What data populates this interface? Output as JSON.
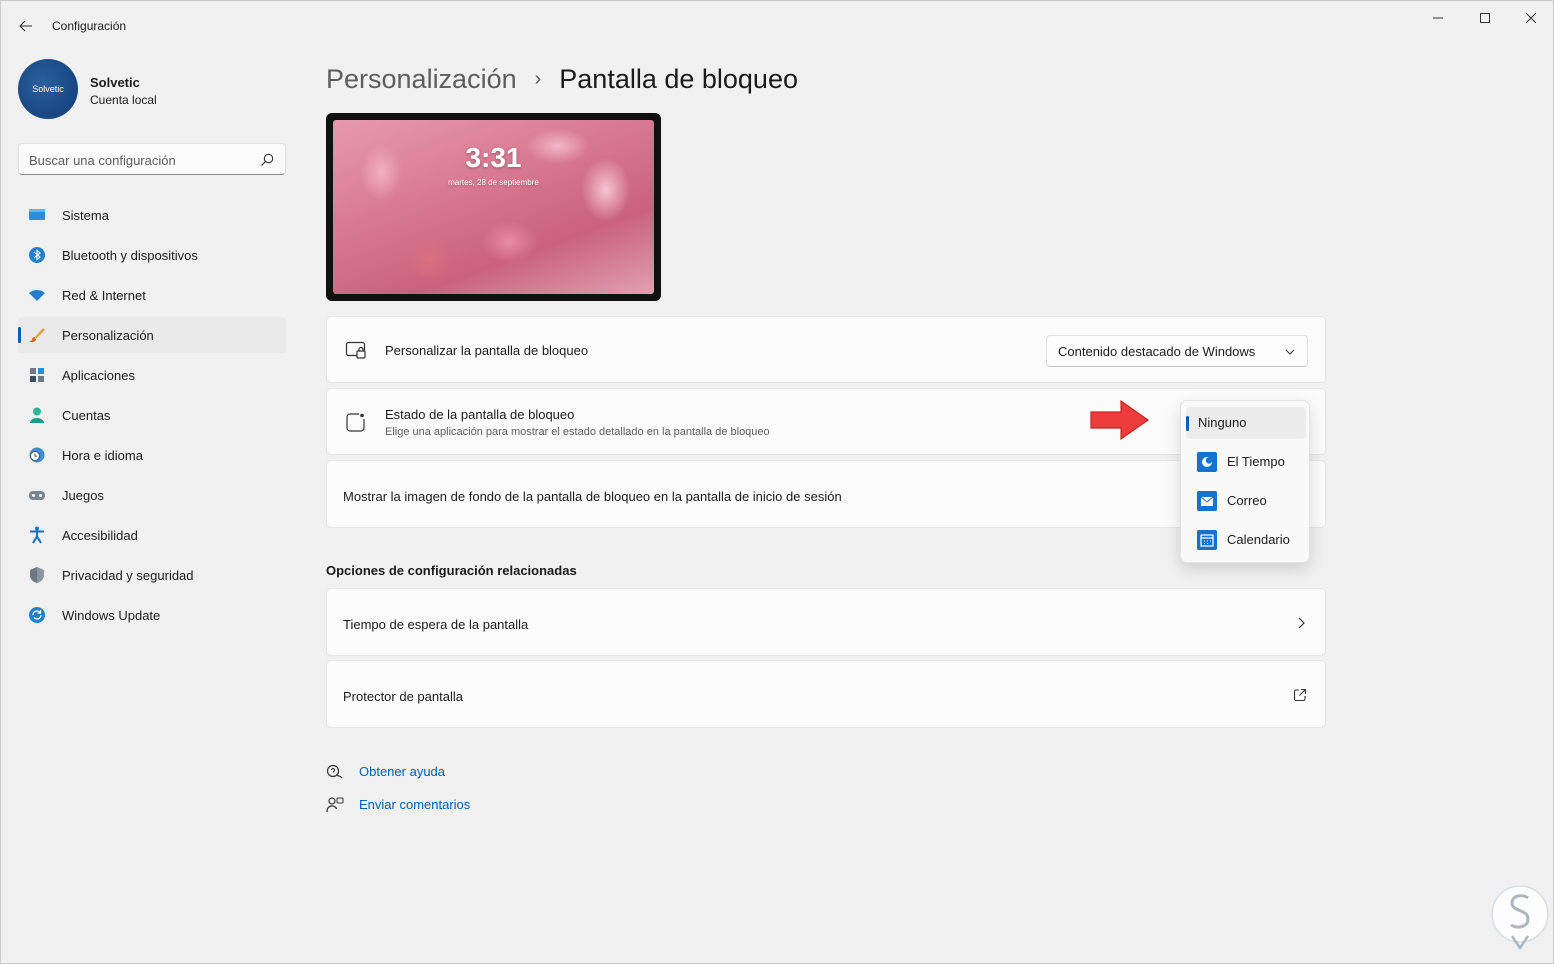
{
  "window": {
    "title": "Configuración",
    "controls": {
      "minimize": "minimize-icon",
      "maximize": "maximize-icon",
      "close": "close-icon"
    }
  },
  "profile": {
    "avatar_text": "Solvetic",
    "name": "Solvetic",
    "account": "Cuenta local"
  },
  "search": {
    "placeholder": "Buscar una configuración"
  },
  "sidebar": {
    "items": [
      {
        "label": "Sistema",
        "icon": "system-icon"
      },
      {
        "label": "Bluetooth y dispositivos",
        "icon": "bluetooth-icon"
      },
      {
        "label": "Red & Internet",
        "icon": "wifi-icon"
      },
      {
        "label": "Personalización",
        "icon": "brush-icon",
        "active": true
      },
      {
        "label": "Aplicaciones",
        "icon": "apps-icon"
      },
      {
        "label": "Cuentas",
        "icon": "person-icon"
      },
      {
        "label": "Hora e idioma",
        "icon": "clock-globe-icon"
      },
      {
        "label": "Juegos",
        "icon": "gamepad-icon"
      },
      {
        "label": "Accesibilidad",
        "icon": "accessibility-icon"
      },
      {
        "label": "Privacidad y seguridad",
        "icon": "shield-icon"
      },
      {
        "label": "Windows Update",
        "icon": "update-icon"
      }
    ]
  },
  "breadcrumb": {
    "parent": "Personalización",
    "separator": "›",
    "current": "Pantalla de bloqueo"
  },
  "preview": {
    "time": "3:31",
    "date": "martes, 28 de septiembre"
  },
  "settings": {
    "personalize": {
      "title": "Personalizar la pantalla de bloqueo",
      "value": "Contenido destacado de Windows"
    },
    "status": {
      "title": "Estado de la pantalla de bloqueo",
      "subtitle": "Elige una aplicación para mostrar el estado detallado en la pantalla de bloqueo"
    },
    "show_background": {
      "title": "Mostrar la imagen de fondo de la pantalla de bloqueo en la pantalla de inicio de sesión"
    }
  },
  "status_dropdown": {
    "options": [
      {
        "label": "Ninguno",
        "selected": true
      },
      {
        "label": "El Tiempo",
        "icon": "weather-icon"
      },
      {
        "label": "Correo",
        "icon": "mail-icon"
      },
      {
        "label": "Calendario",
        "icon": "calendar-icon"
      }
    ]
  },
  "related": {
    "title": "Opciones de configuración relacionadas",
    "items": [
      {
        "label": "Tiempo de espera de la pantalla",
        "icon": "chevron-right-icon"
      },
      {
        "label": "Protector de pantalla",
        "icon": "external-link-icon"
      }
    ]
  },
  "help": {
    "get_help": "Obtener ayuda",
    "feedback": "Enviar comentarios"
  },
  "colors": {
    "accent": "#005fb8",
    "annotation_arrow": "#ee3b3b"
  }
}
